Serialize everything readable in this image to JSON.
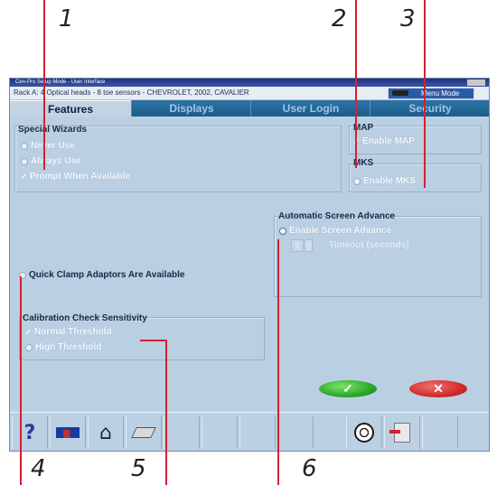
{
  "callouts": {
    "c1": "1",
    "c2": "2",
    "c3": "3",
    "c4": "4",
    "c5": "5",
    "c6": "6"
  },
  "window": {
    "title": "Cen-Pro Setup Mode - User Interface",
    "info": "Rack A: 4 Optical heads - 8 toe sensors - CHEVROLET, 2002, CAVALIER",
    "mode_button": "Menu Mode"
  },
  "tabs": [
    "Features",
    "Displays",
    "User Login",
    "Security"
  ],
  "special_wizards": {
    "title": "Special Wizards",
    "never": "Never Use",
    "always": "Always Use",
    "prompt": "Prompt When Available"
  },
  "map": {
    "title": "MAP",
    "enable": "Enable MAP"
  },
  "mks": {
    "title": "MKS",
    "enable": "Enable MKS"
  },
  "auto_advance": {
    "title": "Automatic Screen Advance",
    "enable": "Enable Screen Advance",
    "timeout_value": "5",
    "timeout_label": "Timeout (seconds)"
  },
  "quick_clamp": "Quick Clamp Adaptors Are Available",
  "calibration": {
    "title": "Calibration Check Sensitivity",
    "normal": "Normal Threshold",
    "high": "High Threshold"
  },
  "buttons": {
    "ok": "✓",
    "cancel": "✕"
  },
  "toolbar_icons": [
    "help-icon",
    "display-icon",
    "home-icon",
    "eraser-icon",
    "target-icon",
    "exit-icon"
  ],
  "colors": {
    "accent": "#1d5b89",
    "ok": "#2ca72b",
    "cancel": "#d22a2a",
    "callout_line": "#d42030"
  }
}
